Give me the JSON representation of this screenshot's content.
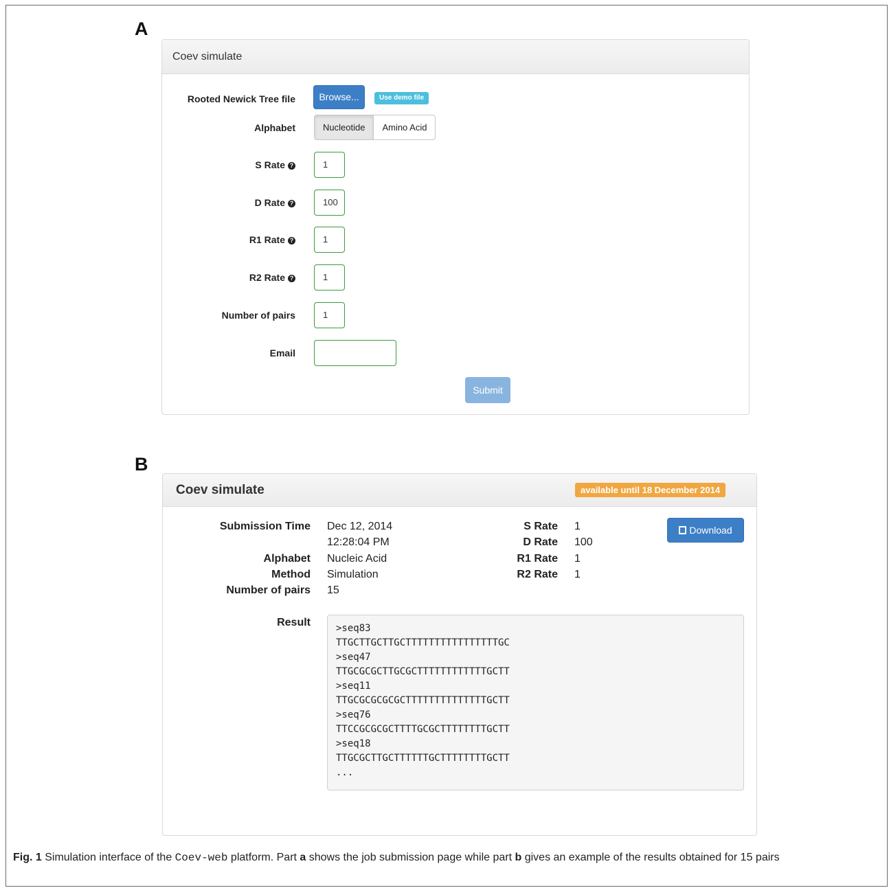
{
  "labels": {
    "part_a": "A",
    "part_b": "B"
  },
  "panel_a": {
    "title": "Coev simulate",
    "tree_label": "Rooted Newick Tree file",
    "browse_label": "Browse...",
    "demo_label": "Use demo file",
    "alphabet_label": "Alphabet",
    "alphabet_options": [
      "Nucleotide",
      "Amino Acid"
    ],
    "alphabet_selected": "Nucleotide",
    "fields": [
      {
        "label": "S Rate",
        "value": "1",
        "help": true
      },
      {
        "label": "D Rate",
        "value": "100",
        "help": true
      },
      {
        "label": "R1 Rate",
        "value": "1",
        "help": true
      },
      {
        "label": "R2 Rate",
        "value": "1",
        "help": true
      },
      {
        "label": "Number of pairs",
        "value": "1",
        "help": false
      }
    ],
    "email_label": "Email",
    "email_value": "",
    "submit_label": "Submit",
    "help_icon_name": "question-circle-icon"
  },
  "panel_b": {
    "title": "Coev simulate",
    "badge": "available until 18 December 2014",
    "badge_color": "#f0a741",
    "left_info": {
      "submission_time_label": "Submission Time",
      "submission_date": "Dec 12, 2014",
      "submission_time": "12:28:04 PM",
      "alphabet_label": "Alphabet",
      "alphabet_value": "Nucleic Acid",
      "method_label": "Method",
      "method_value": "Simulation",
      "pairs_label": "Number of pairs",
      "pairs_value": "15"
    },
    "rates": [
      {
        "label": "S Rate",
        "value": "1"
      },
      {
        "label": "D Rate",
        "value": "100"
      },
      {
        "label": "R1 Rate",
        "value": "1"
      },
      {
        "label": "R2 Rate",
        "value": "1"
      }
    ],
    "download_label": "Download",
    "download_icon": "save-icon",
    "result_label": "Result",
    "result_lines": [
      ">seq83",
      "TTGCTTGCTTGCTTTTTTTTTTTTTTTTGC",
      ">seq47",
      "TTGCGCGCTTGCGCTTTTTTTTTTTTGCTT",
      ">seq11",
      "TTGCGCGCGCGCTTTTTTTTTTTTTTGCTT",
      ">seq76",
      "TTCCGCGCGCTTTTGCGCTTTTTTTTGCTT",
      ">seq18",
      "TTGCGCTTGCTTTTTTGCTTTTTTTTGCTT",
      "..."
    ]
  },
  "caption": {
    "fig": "Fig. 1",
    "text1": " Simulation interface of the ",
    "mono": "Coev-web",
    "text2": " platform. Part ",
    "a": "a",
    "text3": " shows the job submission page while part ",
    "b": "b",
    "text4": " gives an example of the results obtained for 15 pairs"
  },
  "colors": {
    "primary": "#3c7fc6",
    "success_border": "#3c9a3c",
    "info": "#4cbfdd",
    "warning": "#f0a741"
  }
}
